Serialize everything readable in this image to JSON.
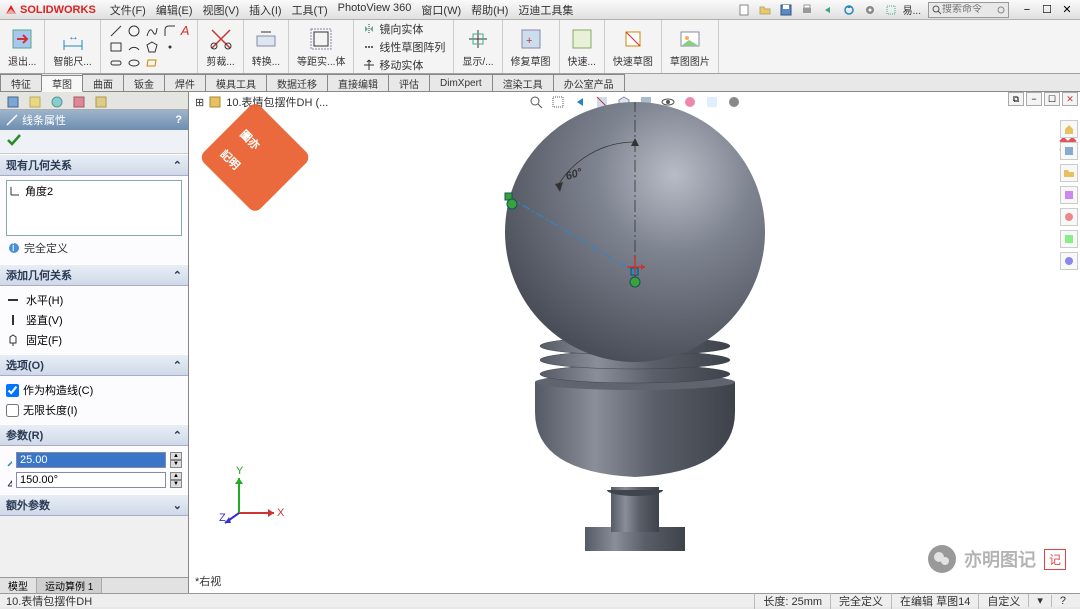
{
  "app": {
    "logo_text": "SOLIDWORKS"
  },
  "menus": [
    "文件(F)",
    "编辑(E)",
    "视图(V)",
    "插入(I)",
    "工具(T)",
    "PhotoView 360",
    "窗口(W)",
    "帮助(H)",
    "迈迪工具集"
  ],
  "search_placeholder": "搜索命令",
  "ribbon": {
    "exit": "退出...",
    "smart_dim": "智能尺...",
    "trim": "剪裁...",
    "convert": "转换...",
    "offset": "等距实...体",
    "mirror": "镜向实体",
    "linear_pattern": "线性草图阵列",
    "move": "移动实体",
    "display_del": "显示/...",
    "repair": "修复草图",
    "quick": "快速...",
    "quick_sketch": "快速草图",
    "sketch_pic": "草图图片"
  },
  "cmd_tabs": [
    "特征",
    "草图",
    "曲面",
    "钣金",
    "焊件",
    "模具工具",
    "数据迁移",
    "直接编辑",
    "评估",
    "DimXpert",
    "渲染工具",
    "办公室产品"
  ],
  "cmd_active_index": 1,
  "doc_title": "10.表情包摆件DH  (...",
  "left": {
    "property_title": "线条属性",
    "question": "?",
    "existing_rel_head": "现有几何关系",
    "existing_rel_item": "角度2",
    "fully_defined": "完全定义",
    "add_rel_head": "添加几何关系",
    "horizontal": "水平(H)",
    "vertical": "竖直(V)",
    "fixed": "固定(F)",
    "options_head": "选项(O)",
    "construction": "作为构造线(C)",
    "construction_checked": true,
    "infinite": "无限长度(I)",
    "infinite_checked": false,
    "params_head": "参数(R)",
    "length_value": "25.00",
    "angle_value": "150.00°",
    "extra_params_head": "额外参数",
    "bottom_tabs": [
      "模型",
      "运动算例 1"
    ],
    "bottom_active": 1
  },
  "viewport": {
    "angle_dim": "60°",
    "view_label": "*右视",
    "triad": {
      "x": "X",
      "y": "Y",
      "z": "Z"
    }
  },
  "watermark": {
    "wechat": "亦明图记",
    "seal": "记"
  },
  "status": {
    "file": "10.表情包摆件DH",
    "length": "长度: 25mm",
    "state": "完全定义",
    "editing": "在编辑 草图14",
    "custom": "自定义"
  }
}
